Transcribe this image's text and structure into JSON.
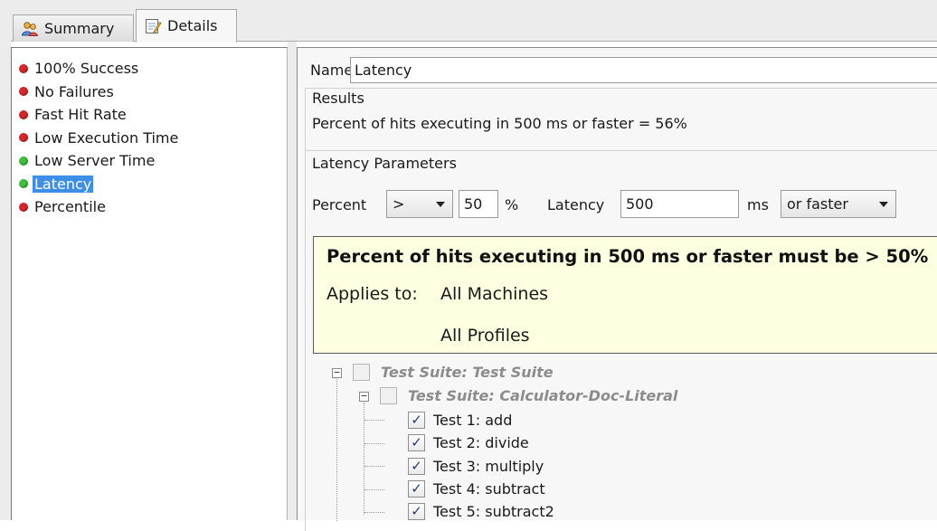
{
  "tabs": [
    {
      "label": "Summary",
      "icon": "summary-people-icon",
      "active": false
    },
    {
      "label": "Details",
      "icon": "details-notepad-icon",
      "active": true
    }
  ],
  "rules": [
    {
      "label": "100% Success",
      "status": "fail"
    },
    {
      "label": "No Failures",
      "status": "fail"
    },
    {
      "label": "Fast Hit Rate",
      "status": "fail"
    },
    {
      "label": "Low Execution Time",
      "status": "fail"
    },
    {
      "label": "Low Server Time",
      "status": "pass"
    },
    {
      "label": "Latency",
      "status": "pass",
      "selected": true
    },
    {
      "label": "Percentile",
      "status": "fail"
    }
  ],
  "colors": {
    "fail": "#d8262a",
    "pass": "#3ec13b",
    "selection": "#3d8ee8",
    "tooltip_bg": "#ffffe1"
  },
  "detail": {
    "name_label": "Name",
    "name_value": "Latency",
    "results_title": "Results",
    "results_text": "Percent of hits executing in 500 ms or faster = 56%",
    "params_title": "Latency Parameters",
    "percent_label": "Percent",
    "operator": ">",
    "percent_value": "50",
    "percent_unit": "%",
    "latency_label": "Latency",
    "latency_value": "500",
    "latency_unit": "ms",
    "speed_option": "or faster"
  },
  "tooltip": {
    "headline": "Percent of hits executing in 500 ms or faster must be > 50%",
    "applies_label": "Applies to:",
    "machines": "All Machines",
    "profiles": "All Profiles"
  },
  "tree": {
    "root_suite": "Test Suite: Test Suite",
    "child_suite": "Test Suite: Calculator-Doc-Literal",
    "tests": [
      {
        "label": "Test 1: add",
        "checked": true
      },
      {
        "label": "Test 2: divide",
        "checked": true
      },
      {
        "label": "Test 3: multiply",
        "checked": true
      },
      {
        "label": "Test 4: subtract",
        "checked": true
      },
      {
        "label": "Test 5: subtract2",
        "checked": true
      }
    ],
    "check_mark": "✓",
    "expander_symbol": "−"
  }
}
